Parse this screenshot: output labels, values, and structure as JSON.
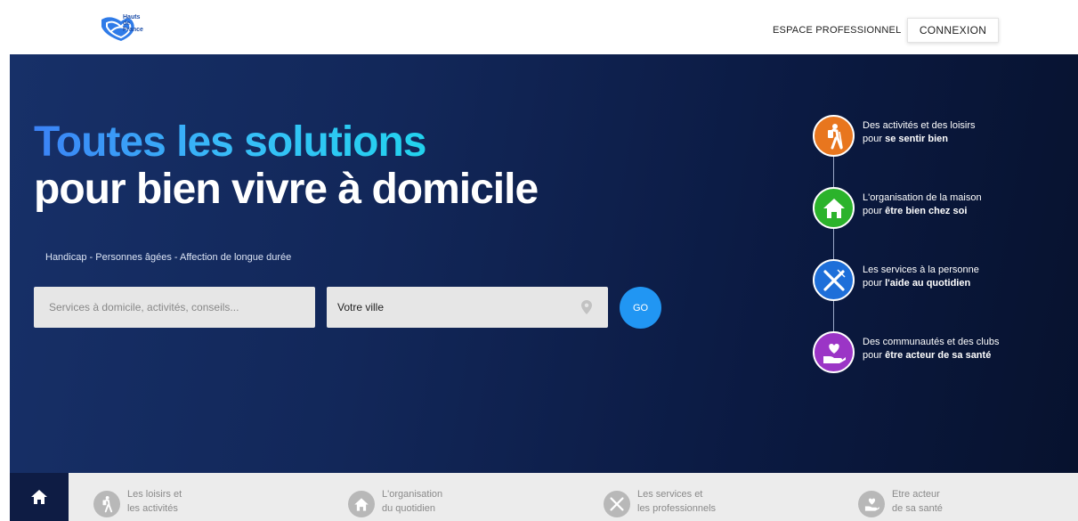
{
  "header": {
    "logo_lines": [
      "Hauts",
      "de",
      "France"
    ],
    "pro_link": "ESPACE PROFESSIONNEL",
    "login_button": "CONNEXION"
  },
  "hero": {
    "title_line1": "Toutes les solutions",
    "title_line2": "pour bien vivre à domicile",
    "subtitle": "Handicap - Personnes âgées - Affection de longue durée",
    "search": {
      "placeholder": "Services à domicile, activités, conseils...",
      "city_placeholder": "Votre ville",
      "go_label": "GO"
    }
  },
  "features": [
    {
      "line1": "Des activités et des loisirs",
      "prefix": "pour ",
      "bold": "se sentir bien",
      "color": "#e8761e",
      "icon": "hiker-icon"
    },
    {
      "line1": "L'organisation de la maison",
      "prefix": "pour ",
      "bold": "être bien chez soi",
      "color": "#2bb32b",
      "icon": "house-icon"
    },
    {
      "line1": "Les services à la personne",
      "prefix": "pour ",
      "bold": "l'aide au quotidien",
      "color": "#1e6fd9",
      "icon": "fork-knife-icon"
    },
    {
      "line1": "Des communautés et des clubs",
      "prefix": "pour ",
      "bold": "être acteur de sa santé",
      "color": "#9b35c6",
      "icon": "heart-hand-icon"
    }
  ],
  "bottom_nav": {
    "items": [
      {
        "line1": "Les loisirs et",
        "line2": "les activités",
        "icon": "hiker-icon"
      },
      {
        "line1": "L'organisation",
        "line2": "du quotidien",
        "icon": "house-icon"
      },
      {
        "line1": "Les services et",
        "line2": "les professionnels",
        "icon": "fork-knife-icon"
      },
      {
        "line1": "Etre acteur",
        "line2": "de sa santé",
        "icon": "heart-hand-icon"
      }
    ]
  }
}
